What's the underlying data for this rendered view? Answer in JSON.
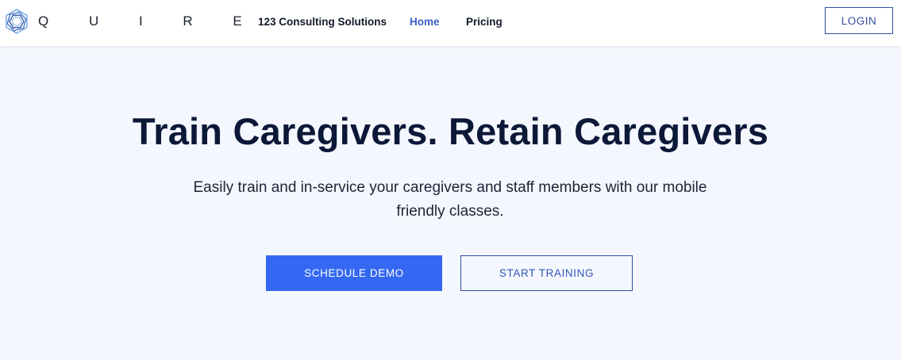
{
  "header": {
    "logo_text": "Q U I R E",
    "nav": {
      "company": "123 Consulting Solutions",
      "home": "Home",
      "pricing": "Pricing"
    },
    "login_label": "LOGIN"
  },
  "hero": {
    "title": "Train Caregivers. Retain Caregivers",
    "subtitle": "Easily train and in-service your caregivers and staff members with our mobile friendly classes.",
    "primary_cta": "SCHEDULE DEMO",
    "secondary_cta": "START TRAINING"
  },
  "colors": {
    "background": "#f4f7fd",
    "primary": "#3468f3",
    "nav_active": "#3a62c4",
    "title": "#0c1838"
  },
  "icons": {
    "logo": "quire-logo-icon"
  }
}
